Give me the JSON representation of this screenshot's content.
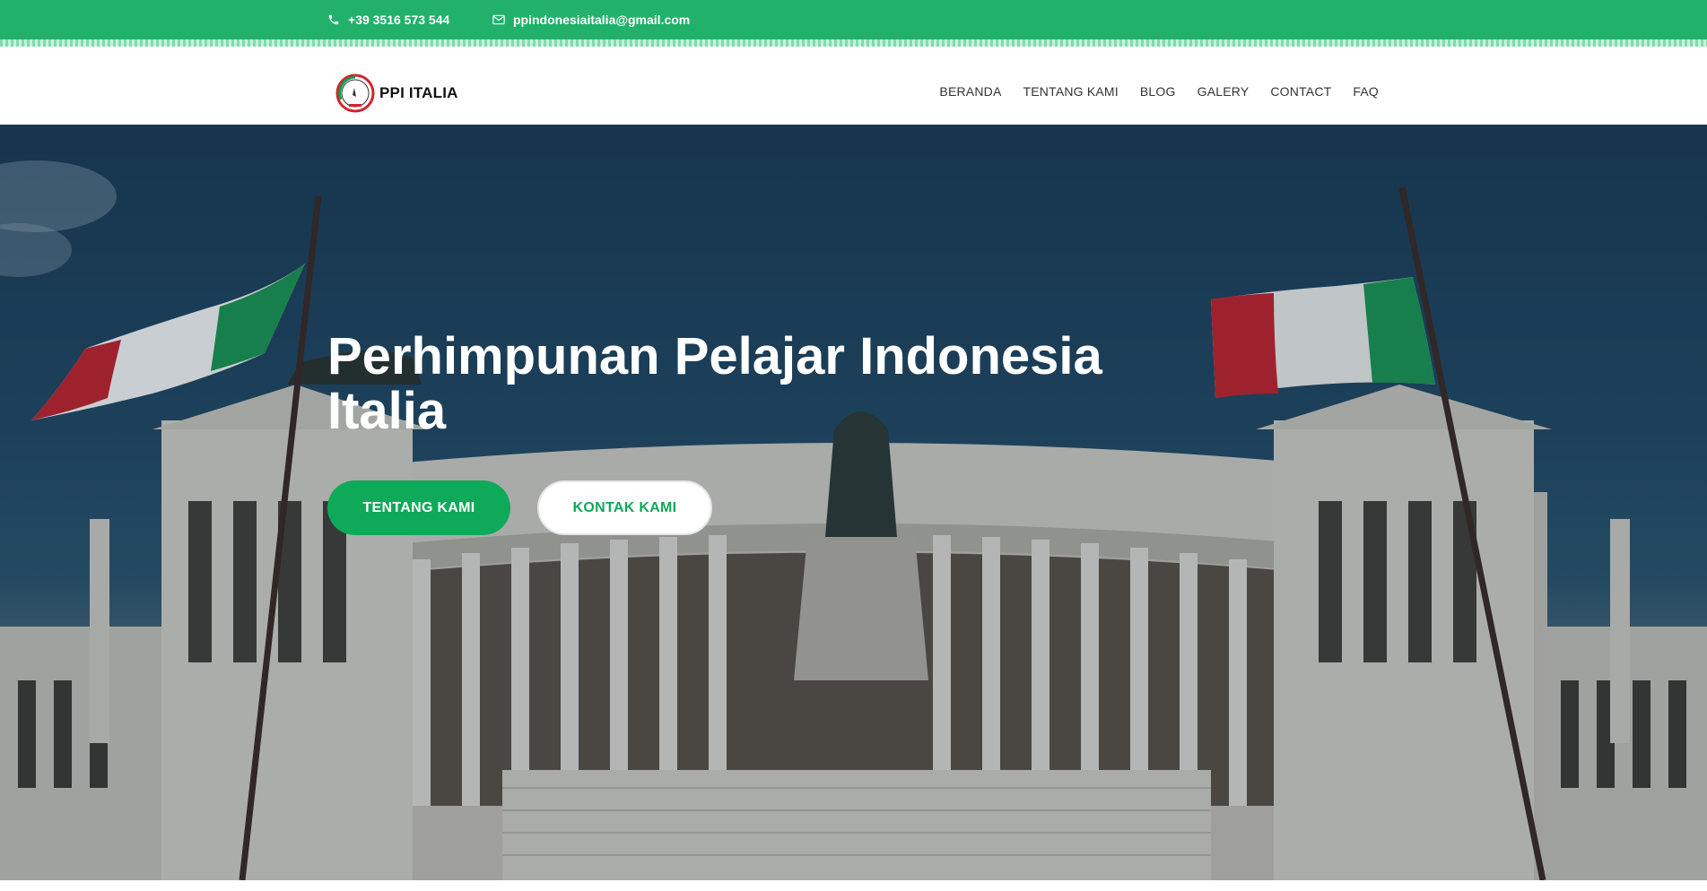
{
  "topbar": {
    "phone": "+39 3516 573 544",
    "email": "ppindonesiaitalia@gmail.com",
    "phone_icon": "phone-icon",
    "email_icon": "envelope-icon",
    "background_color": "#21b16b"
  },
  "header": {
    "logo_text": "PPI ITALIA",
    "logo_icon": "ppi-italia-logo",
    "nav": [
      {
        "label": "BERANDA"
      },
      {
        "label": "TENTANG KAMI"
      },
      {
        "label": "BLOG"
      },
      {
        "label": "GALERY"
      },
      {
        "label": "CONTACT"
      },
      {
        "label": "FAQ"
      }
    ]
  },
  "hero": {
    "title": "Perhimpunan Pelajar Indonesia Italia",
    "primary_button": "TENTANG KAMI",
    "secondary_button": "KONTAK KAMI",
    "accent_color": "#0fa95a"
  }
}
